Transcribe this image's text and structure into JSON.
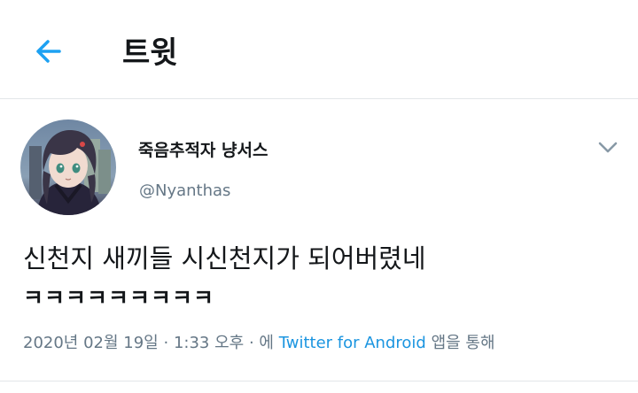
{
  "header": {
    "title": "트윗",
    "back_icon": "arrow-left-icon",
    "accent_color": "#1da1f2"
  },
  "tweet": {
    "author": {
      "display_name": "죽음추적자 냥서스",
      "username": "@Nyanthas",
      "avatar": "anime-character-avatar"
    },
    "more_icon": "chevron-down-icon",
    "text_line1": "신천지 새끼들 시신천지가 되어버렸네",
    "text_line2": "ㅋㅋㅋㅋㅋㅋㅋㅋㅋ",
    "meta": {
      "date": "2020년 02월 19일",
      "separator1": "·",
      "time": "1:33 오후",
      "separator2": "·",
      "prefix": "에",
      "source": "Twitter for Android",
      "suffix": "앱을 통해"
    }
  }
}
